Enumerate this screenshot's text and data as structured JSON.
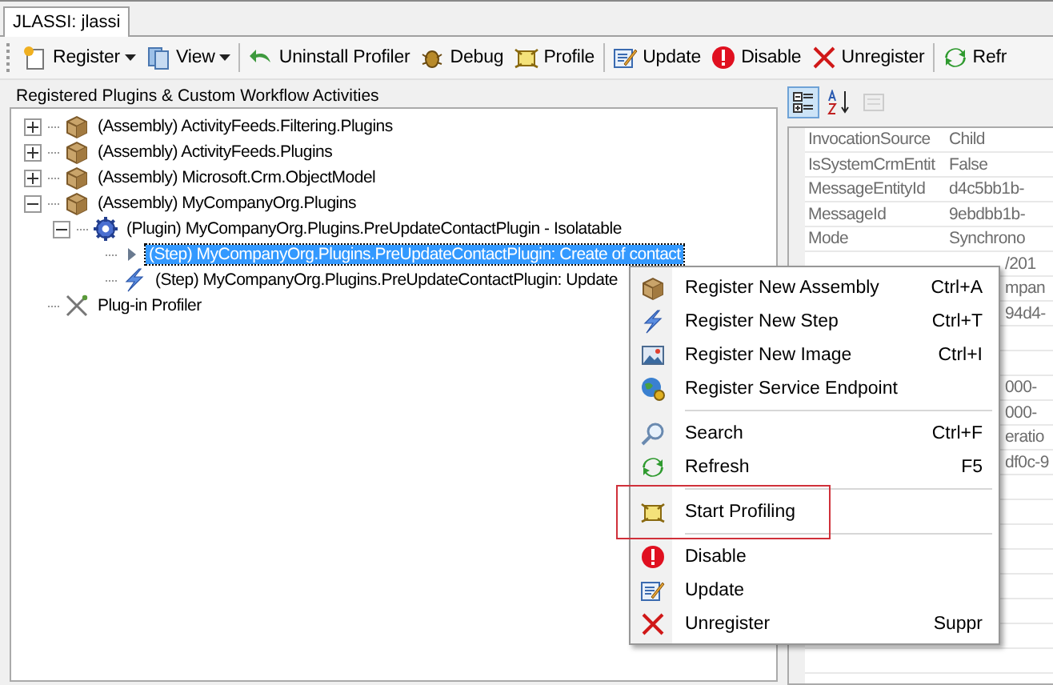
{
  "tabs": [
    {
      "label": "JLASSI: jlassi",
      "selected": true
    }
  ],
  "toolbar": [
    {
      "kind": "register",
      "label": "Register",
      "dropdown": true
    },
    {
      "kind": "view",
      "label": "View",
      "dropdown": true
    },
    {
      "kind": "separator"
    },
    {
      "kind": "uninstall",
      "label": "Uninstall Profiler"
    },
    {
      "kind": "debug",
      "label": "Debug"
    },
    {
      "kind": "profile",
      "label": "Profile"
    },
    {
      "kind": "separator"
    },
    {
      "kind": "update",
      "label": "Update"
    },
    {
      "kind": "disable",
      "label": "Disable"
    },
    {
      "kind": "unregister",
      "label": "Unregister"
    },
    {
      "kind": "separator"
    },
    {
      "kind": "refresh",
      "label": "Refr"
    }
  ],
  "tree": {
    "title": "Registered Plugins & Custom Workflow Activities",
    "items": [
      {
        "kind": "assembly",
        "label": "(Assembly) ActivityFeeds.Filtering.Plugins",
        "expanded": false,
        "selected": false
      },
      {
        "kind": "assembly",
        "label": "(Assembly) ActivityFeeds.Plugins",
        "expanded": false,
        "selected": false
      },
      {
        "kind": "assembly",
        "label": "(Assembly) Microsoft.Crm.ObjectModel",
        "expanded": false,
        "selected": false
      },
      {
        "kind": "assembly",
        "label": "(Assembly) MyCompanyOrg.Plugins",
        "expanded": true,
        "selected": false,
        "children": [
          {
            "kind": "plugin",
            "label": "(Plugin) MyCompanyOrg.Plugins.PreUpdateContactPlugin - Isolatable",
            "expanded": true,
            "selected": false,
            "children": [
              {
                "kind": "step",
                "label": "(Step) MyCompanyOrg.Plugins.PreUpdateContactPlugin: Create of contact",
                "selected": true
              },
              {
                "kind": "step",
                "label": "(Step) MyCompanyOrg.Plugins.PreUpdateContactPlugin: Update",
                "selected": false
              }
            ]
          }
        ]
      },
      {
        "kind": "profiler",
        "label": "Plug-in Profiler",
        "selected": false
      }
    ]
  },
  "properties": {
    "toolbar": [
      {
        "kind": "categorized",
        "selected": true
      },
      {
        "kind": "alphabetical",
        "selected": false
      },
      {
        "kind": "pages",
        "disabled": true
      }
    ],
    "rows": [
      {
        "kind": "full",
        "name": "InvocationSource",
        "value": "Child"
      },
      {
        "kind": "full",
        "name": "IsSystemCrmEntit",
        "value": "False"
      },
      {
        "kind": "full",
        "name": "MessageEntityId",
        "value": "d4c5bb1b-"
      },
      {
        "kind": "full",
        "name": "MessageId",
        "value": "9ebdbb1b-"
      },
      {
        "kind": "full",
        "name": "Mode",
        "value": "Synchrono"
      },
      {
        "kind": "covered",
        "value": "/201"
      },
      {
        "kind": "covered",
        "value": "mpan"
      },
      {
        "kind": "covered",
        "value": "94d4-"
      },
      {
        "kind": "blank"
      },
      {
        "kind": "blank"
      },
      {
        "kind": "covered",
        "value": "000-"
      },
      {
        "kind": "covered",
        "value": "000-"
      },
      {
        "kind": "covered",
        "value": "eratio"
      },
      {
        "kind": "covered",
        "value": "df0c-9"
      }
    ]
  },
  "context_menu": [
    {
      "kind": "assembly",
      "label": "Register New Assembly",
      "shortcut": "Ctrl+A"
    },
    {
      "kind": "step",
      "label": "Register New Step",
      "shortcut": "Ctrl+T"
    },
    {
      "kind": "image",
      "label": "Register New Image",
      "shortcut": "Ctrl+I"
    },
    {
      "kind": "endpoint",
      "label": "Register Service Endpoint"
    },
    {
      "kind": "separator"
    },
    {
      "kind": "search",
      "label": "Search",
      "shortcut": "Ctrl+F"
    },
    {
      "kind": "refresh",
      "label": "Refresh",
      "shortcut": "F5"
    },
    {
      "kind": "separator"
    },
    {
      "kind": "profile",
      "label": "Start Profiling",
      "highlighted": true
    },
    {
      "kind": "separator"
    },
    {
      "kind": "disable",
      "label": "Disable"
    },
    {
      "kind": "update",
      "label": "Update"
    },
    {
      "kind": "unregister",
      "label": "Unregister",
      "shortcut": "Suppr"
    }
  ]
}
